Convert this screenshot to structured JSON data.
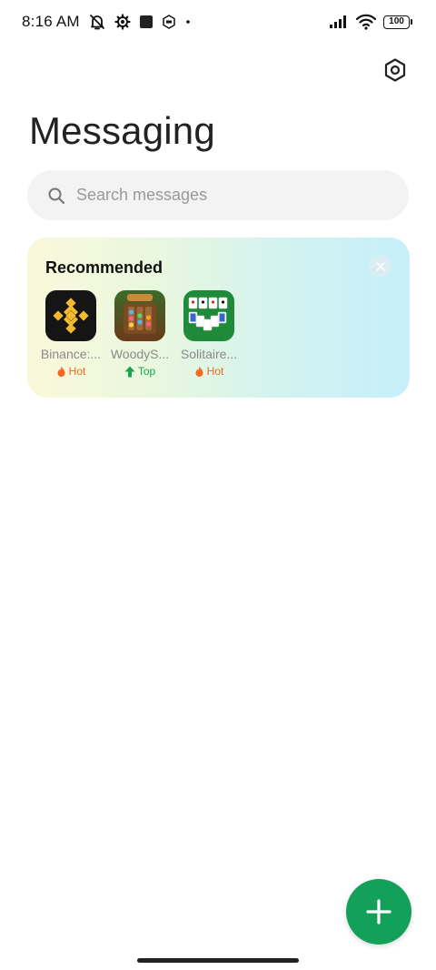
{
  "status_bar": {
    "time": "8:16 AM",
    "left_icons": [
      "muted-bell-icon",
      "gear-icon",
      "square-icon",
      "shield-icon",
      "dot-icon"
    ],
    "right_icons": [
      "signal-icon",
      "wifi-icon",
      "battery-icon"
    ],
    "battery_level": "100"
  },
  "header": {
    "title": "Messaging",
    "settings_icon": "hexagon-settings-icon"
  },
  "search": {
    "placeholder": "Search messages",
    "icon": "search-icon"
  },
  "recommended": {
    "title": "Recommended",
    "close_icon": "close-icon",
    "apps": [
      {
        "name": "Binance:...",
        "badge": "Hot",
        "badge_icon": "flame-icon",
        "badge_color": "#f26a1b"
      },
      {
        "name": "WoodyS...",
        "badge": "Top",
        "badge_icon": "arrow-up-icon",
        "badge_color": "#17a64f"
      },
      {
        "name": "Solitaire...",
        "badge": "Hot",
        "badge_icon": "flame-icon",
        "badge_color": "#f26a1b"
      }
    ]
  },
  "fab": {
    "icon": "plus-icon",
    "color": "#13a15a"
  },
  "colors": {
    "accent": "#13a15a",
    "hot": "#f26a1b",
    "top": "#17a64f"
  }
}
